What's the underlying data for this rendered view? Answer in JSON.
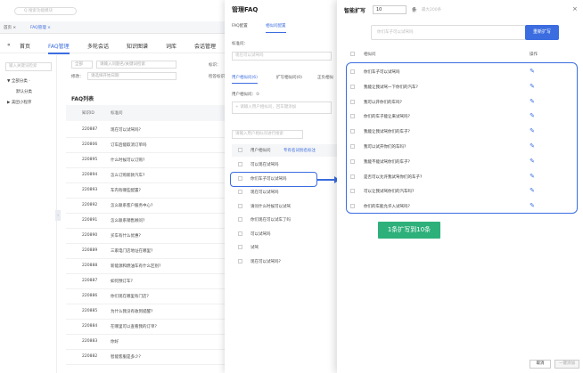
{
  "app": {
    "search_placeholder": "Q 搜索功能模块",
    "tabstrip": [
      "首页 ×",
      "FAQ管理 ×"
    ],
    "nav": [
      "«",
      "首页",
      "FAQ管理",
      "多轮会话",
      "知识图谱",
      "词库",
      "会话管理"
    ],
    "left_panel": {
      "placeholder": "输入关键词检索",
      "items": [
        "▼ 全部分类 ·",
        "默认分类",
        "▶ 美团小程序"
      ]
    },
    "filters": {
      "field1": "全部",
      "field2": "请输入问题名/关键词检索",
      "label1": "修改：",
      "field3": "请选择开始日期",
      "label2": "标识：",
      "label3": "检答标识"
    },
    "list_title": "FAQ列表",
    "table_header": [
      "知识ID",
      "标准问"
    ],
    "rows": [
      {
        "id": "220887",
        "q": "现在可以试驾吗?"
      },
      {
        "id": "220806",
        "q": "订车后能取消订单吗"
      },
      {
        "id": "220895",
        "q": "什么时候可以订购?"
      },
      {
        "id": "220894",
        "q": "怎么订购新款汽车?"
      },
      {
        "id": "220893",
        "q": "车内有哪些配置?"
      },
      {
        "id": "220892",
        "q": "怎么联系客户服务中心?"
      },
      {
        "id": "220891",
        "q": "怎么联系销售顾问?"
      },
      {
        "id": "220890",
        "q": "买车有什么优惠?"
      },
      {
        "id": "220889",
        "q": "三家电门店地址在哪里?"
      },
      {
        "id": "220888",
        "q": "新能源和燃油车有什么区别?"
      },
      {
        "id": "220887",
        "q": "如何预订车?"
      },
      {
        "id": "220886",
        "q": "你们现在哪里有门店?"
      },
      {
        "id": "220885",
        "q": "为什么我没有收到提醒?"
      },
      {
        "id": "220884",
        "q": "在哪里可以查看我的订单?"
      },
      {
        "id": "220883",
        "q": "你好"
      },
      {
        "id": "220882",
        "q": "智能客服是多少?"
      }
    ]
  },
  "drawer": {
    "title": "管理FAQ",
    "tabs": [
      "FAQ配置",
      "相似问配置"
    ],
    "std_label": "标准问：",
    "std_placeholder": "现在可以试驾吗",
    "sub_tabs": [
      "用户相似问(6)",
      "扩写相似问(0)",
      "正负相似"
    ],
    "user_sim_label": "用户相似问：①",
    "user_sim_placeholder": "+ 请输入用户相似问，回车键添加",
    "search_placeholder": "请输入用户相似问进行搜索",
    "col_header": "用户相似问",
    "col_header2": "专有名词别名标注",
    "questions": [
      "可以现在试驾吗",
      "你们车子可以试驾吗",
      "现在可以试驾吗",
      "请问什么时候可以试驾",
      "你们现在可以试车了吗",
      "可以试驾吗",
      "试驾",
      "现在可以试驾吗?"
    ]
  },
  "dialog": {
    "title": "智能扩写",
    "count": "10",
    "unit": "条",
    "max_hint": "最大200条",
    "close": "×",
    "prompt_placeholder": "你们车子可以试驾吗",
    "generate_button": "重新扩写",
    "col_header": "相似问",
    "col_action": "操作",
    "results": [
      "你们车子可以试驾吗",
      "我能让我试驾一下你们的汽车?",
      "我可以开你们的车吗?",
      "你们的车子能让来试驾吗?",
      "我能让我试驾你们的车子?",
      "我可以试开你们的车吗?",
      "我能不能试驾你们的车子?",
      "是否可以允许我试驾你们的车子?",
      "可以让我试驾你们的汽车吗?",
      "你们的车能允许入试驾吗?"
    ],
    "badge": "1条扩写到10条",
    "cancel": "取消",
    "ok": "一键添加"
  }
}
